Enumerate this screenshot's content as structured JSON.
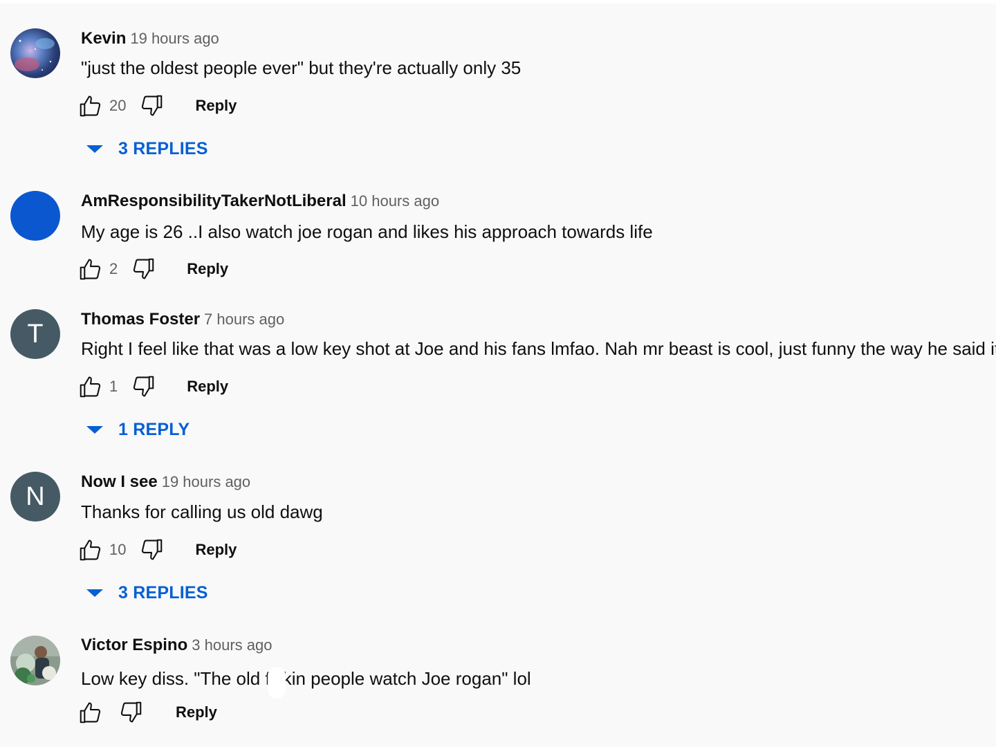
{
  "comments": [
    {
      "author": "Kevin",
      "time": "19 hours ago",
      "text": "\"just the oldest people ever\" but they're actually only 35",
      "likes": "20",
      "reply_label": "Reply",
      "replies_label": "3 REPLIES",
      "avatar": "galaxy-photo"
    },
    {
      "author": "AmResponsibilityTakerNotLiberal",
      "time": "10 hours ago",
      "text": "My age is  26 ..I also watch joe rogan and likes his approach towards life",
      "likes": "2",
      "reply_label": "Reply",
      "avatar": "blue-circle"
    },
    {
      "author": "Thomas Foster",
      "time": "7 hours ago",
      "text": "Right I feel like that was a low key shot at Joe and his fans lmfao. Nah mr beast is cool, just funny the way he said it.",
      "likes": "1",
      "reply_label": "Reply",
      "replies_label": "1 REPLY",
      "avatar_letter": "T"
    },
    {
      "author": "Now I see",
      "time": "19 hours ago",
      "text": "Thanks for calling us old dawg",
      "likes": "10",
      "reply_label": "Reply",
      "replies_label": "3 REPLIES",
      "avatar_letter": "N"
    },
    {
      "author": "Victor Espino",
      "time": "3 hours ago",
      "text_before": "Low key diss. \"The old f",
      "text_after": "kin people watch Joe rogan\" lol",
      "likes": "",
      "reply_label": "Reply",
      "avatar": "person-photo"
    }
  ],
  "colors": {
    "link_blue": "#065fd4",
    "background": "#f9f9f9",
    "secondary_text": "#606060",
    "letter_avatar": "#455a64",
    "blue_avatar": "#0b57d0"
  },
  "icons": {
    "like": "thumbs-up-icon",
    "dislike": "thumbs-down-icon",
    "expand": "caret-down-icon"
  }
}
